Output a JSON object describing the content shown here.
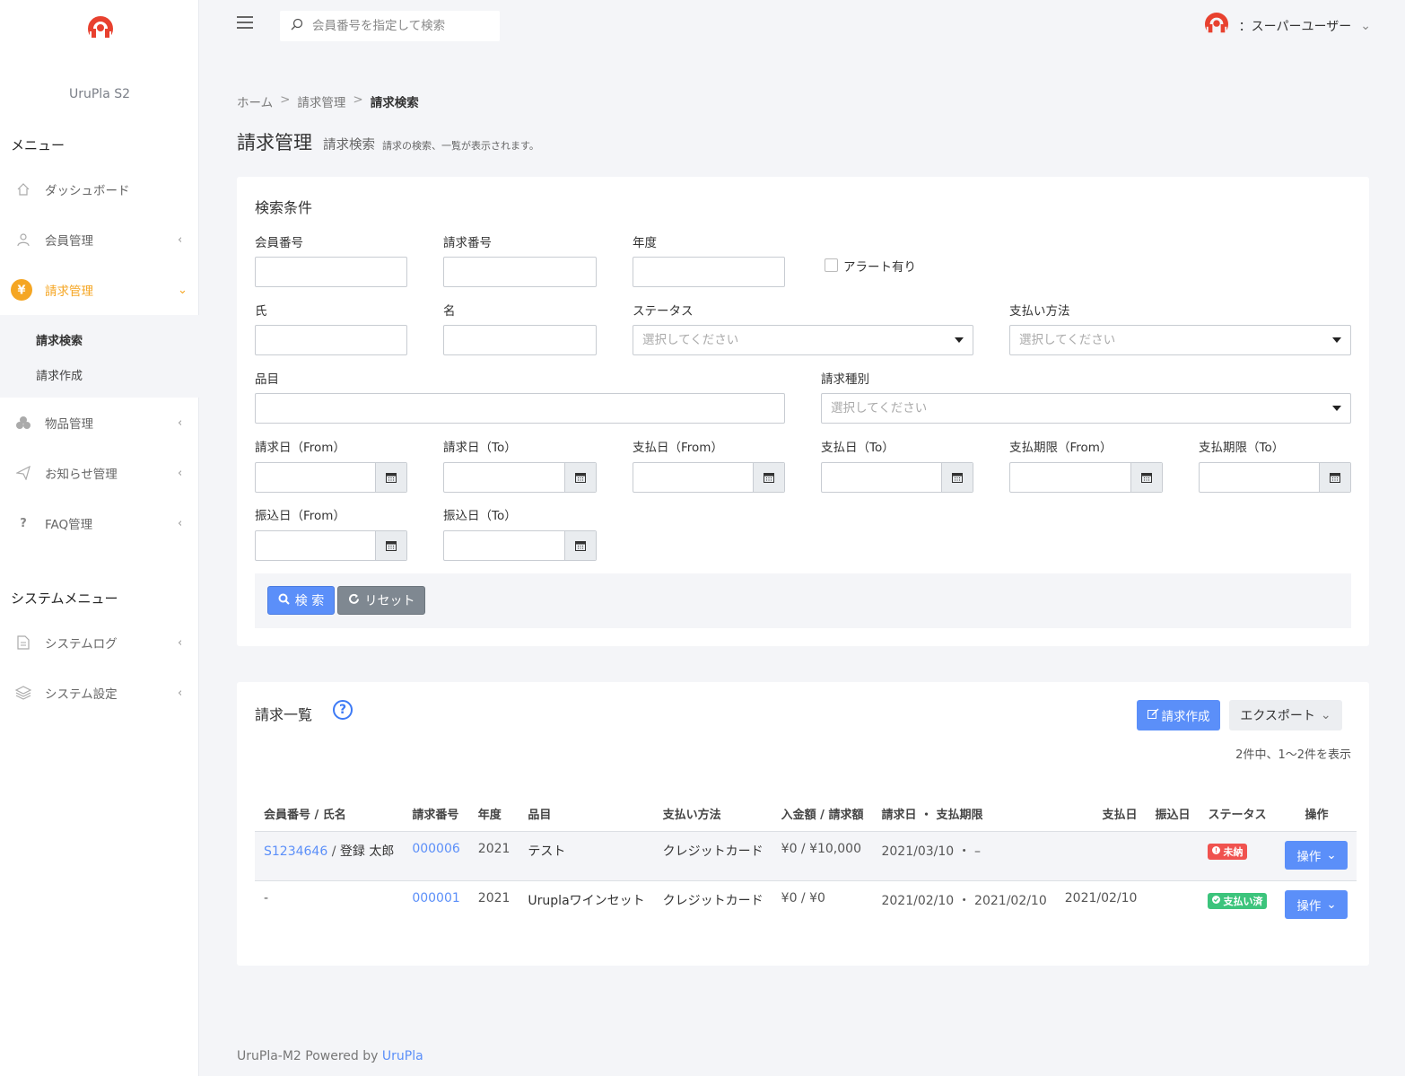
{
  "sidebar": {
    "brand": "UruPla S2",
    "menu_heading": "メニュー",
    "items": [
      {
        "label": "ダッシュボード"
      },
      {
        "label": "会員管理"
      },
      {
        "label": "請求管理"
      },
      {
        "label": "物品管理"
      },
      {
        "label": "お知らせ管理"
      },
      {
        "label": "FAQ管理"
      }
    ],
    "sub_items": [
      {
        "label": "請求検索"
      },
      {
        "label": "請求作成"
      }
    ],
    "system_heading": "システムメニュー",
    "system_items": [
      {
        "label": "システムログ"
      },
      {
        "label": "システム設定"
      }
    ],
    "active_color": "#f5a623"
  },
  "topbar": {
    "search_placeholder": "会員番号を指定して検索",
    "user_label": "：スーパーユーザー"
  },
  "breadcrumb": [
    "ホーム",
    ">",
    "請求管理",
    ">",
    "請求検索"
  ],
  "page": {
    "title": "請求管理",
    "subtitle": "請求検索",
    "description": "請求の検索、一覧が表示されます。"
  },
  "search": {
    "title": "検索条件",
    "labels": {
      "member_no": "会員番号",
      "invoice_no": "請求番号",
      "year": "年度",
      "alert": "アラート有り",
      "last_name": "氏",
      "first_name": "名",
      "status": "ステータス",
      "payment_method": "支払い方法",
      "item": "品目",
      "invoice_type": "請求種別",
      "invoice_date_from": "請求日（From）",
      "invoice_date_to": "請求日（To）",
      "payment_date_from": "支払日（From）",
      "payment_date_to": "支払日（To）",
      "due_from": "支払期限（From）",
      "due_to": "支払期限（To）",
      "transfer_from": "振込日（From）",
      "transfer_to": "振込日（To）"
    },
    "select_placeholder": "選択してください",
    "search_button": "検 索",
    "reset_button": "リセット"
  },
  "list": {
    "title": "請求一覧",
    "help": "?",
    "create_button": "請求作成",
    "export_button": "エクスポート",
    "count_text": "2件中、1〜2件を表示",
    "columns": [
      "会員番号 / 氏名",
      "請求番号",
      "年度",
      "品目",
      "支払い方法",
      "入金額 / 請求額",
      "請求日 ・ 支払期限",
      "支払日",
      "振込日",
      "ステータス",
      "操作"
    ],
    "rows": [
      {
        "member_no": "S1234646",
        "sep": " / ",
        "name": "登録 太郎",
        "invoice_no": "000006",
        "year": "2021",
        "item": "テスト",
        "method": "クレジットカード",
        "amount": "¥0 / ¥10,000",
        "dates": "2021/03/10 ・ –",
        "paid": "",
        "transfer": "",
        "status": "未納",
        "op": "操作"
      },
      {
        "member_no": "-",
        "sep": "",
        "name": "",
        "invoice_no": "000001",
        "year": "2021",
        "item": "Uruplaワインセット",
        "method": "クレジットカード",
        "amount": "¥0 / ¥0",
        "dates": "2021/02/10 ・ 2021/02/10",
        "paid": "2021/02/10",
        "transfer": "",
        "status": "支払い済",
        "op": "操作"
      }
    ]
  },
  "footer": {
    "text": "UruPla-M2 Powered by ",
    "link": "UruPla"
  }
}
